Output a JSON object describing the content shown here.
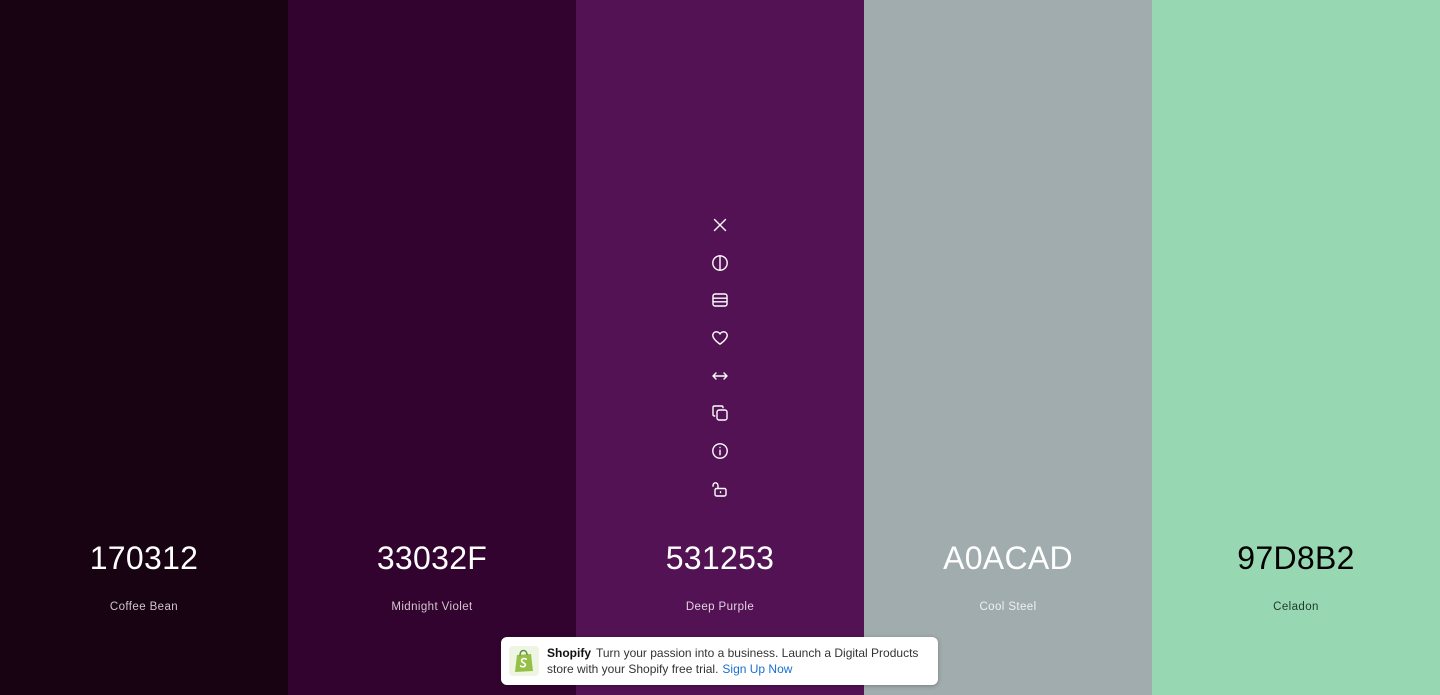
{
  "palette": {
    "swatches": [
      {
        "hex": "170312",
        "name": "Coffee Bean",
        "color": "#170312",
        "hex_text_color": "#ffffff",
        "name_text_color": "#cfc6cc"
      },
      {
        "hex": "33032F",
        "name": "Midnight Violet",
        "color": "#33032F",
        "hex_text_color": "#ffffff",
        "name_text_color": "#d3c6d1"
      },
      {
        "hex": "531253",
        "name": "Deep Purple",
        "color": "#531253",
        "hex_text_color": "#ffffff",
        "name_text_color": "#e2d3e2"
      },
      {
        "hex": "A0ACAD",
        "name": "Cool Steel",
        "color": "#A0ACAD",
        "hex_text_color": "#ffffff",
        "name_text_color": "#eef1f1"
      },
      {
        "hex": "97D8B2",
        "name": "Celadon",
        "color": "#97D8B2",
        "hex_text_color": "#000000",
        "name_text_color": "#1f3a2b"
      }
    ],
    "active_swatch_tools": [
      {
        "icon": "close-icon"
      },
      {
        "icon": "contrast-icon"
      },
      {
        "icon": "shades-icon"
      },
      {
        "icon": "heart-icon"
      },
      {
        "icon": "drag-arrows-icon"
      },
      {
        "icon": "copy-icon"
      },
      {
        "icon": "info-icon"
      },
      {
        "icon": "lock-open-icon"
      }
    ]
  },
  "ad": {
    "brand": "Shopify",
    "message": "Turn your passion into a business. Launch a Digital Products store with your Shopify free trial.",
    "cta": "Sign Up Now",
    "logo_icon": "shopify-bag-icon",
    "logo_color": "#95bf47",
    "cta_color": "#1a6fd1"
  }
}
